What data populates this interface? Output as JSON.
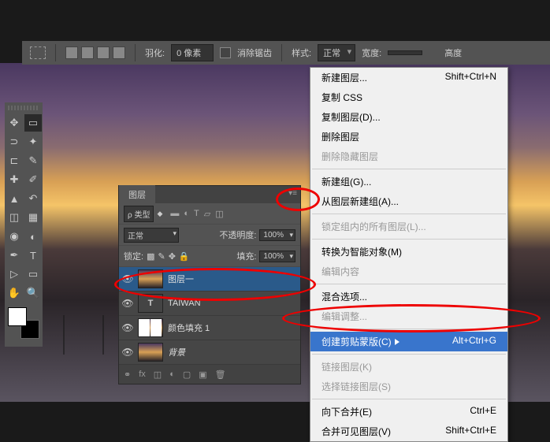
{
  "topbar": {
    "feather_label": "羽化:",
    "feather_value": "0 像素",
    "antialias": "消除锯齿",
    "style_label": "样式:",
    "style_value": "正常",
    "width_label": "宽度:",
    "height_label": "高度"
  },
  "layers": {
    "tab": "图层",
    "kind_label": "ρ 类型",
    "blend_mode": "正常",
    "opacity_label": "不透明度:",
    "opacity_value": "100%",
    "lock_label": "锁定:",
    "fill_label": "填充:",
    "fill_value": "100%",
    "items": [
      {
        "name": "图层一",
        "type": "image",
        "selected": true
      },
      {
        "name": "TAIWAN",
        "type": "text"
      },
      {
        "name": "颜色填充 1",
        "type": "fill"
      },
      {
        "name": "背景",
        "type": "bg"
      }
    ]
  },
  "menu": {
    "items": [
      {
        "label": "新建图层...",
        "shortcut": "Shift+Ctrl+N"
      },
      {
        "label": "复制 CSS"
      },
      {
        "label": "复制图层(D)..."
      },
      {
        "label": "删除图层"
      },
      {
        "label": "删除隐藏图层",
        "disabled": true
      },
      {
        "sep": true
      },
      {
        "label": "新建组(G)..."
      },
      {
        "label": "从图层新建组(A)..."
      },
      {
        "sep": true
      },
      {
        "label": "锁定组内的所有图层(L)...",
        "disabled": true
      },
      {
        "sep": true
      },
      {
        "label": "转换为智能对象(M)"
      },
      {
        "label": "编辑内容",
        "disabled": true
      },
      {
        "sep": true
      },
      {
        "label": "混合选项..."
      },
      {
        "label": "编辑调整...",
        "disabled": true
      },
      {
        "sep": true
      },
      {
        "label": "创建剪贴蒙版(C)",
        "shortcut": "Alt+Ctrl+G",
        "hover": true
      },
      {
        "sep": true
      },
      {
        "label": "链接图层(K)",
        "disabled": true
      },
      {
        "label": "选择链接图层(S)",
        "disabled": true
      },
      {
        "sep": true
      },
      {
        "label": "向下合并(E)",
        "shortcut": "Ctrl+E"
      },
      {
        "label": "合并可见图层(V)",
        "shortcut": "Shift+Ctrl+E"
      }
    ]
  }
}
